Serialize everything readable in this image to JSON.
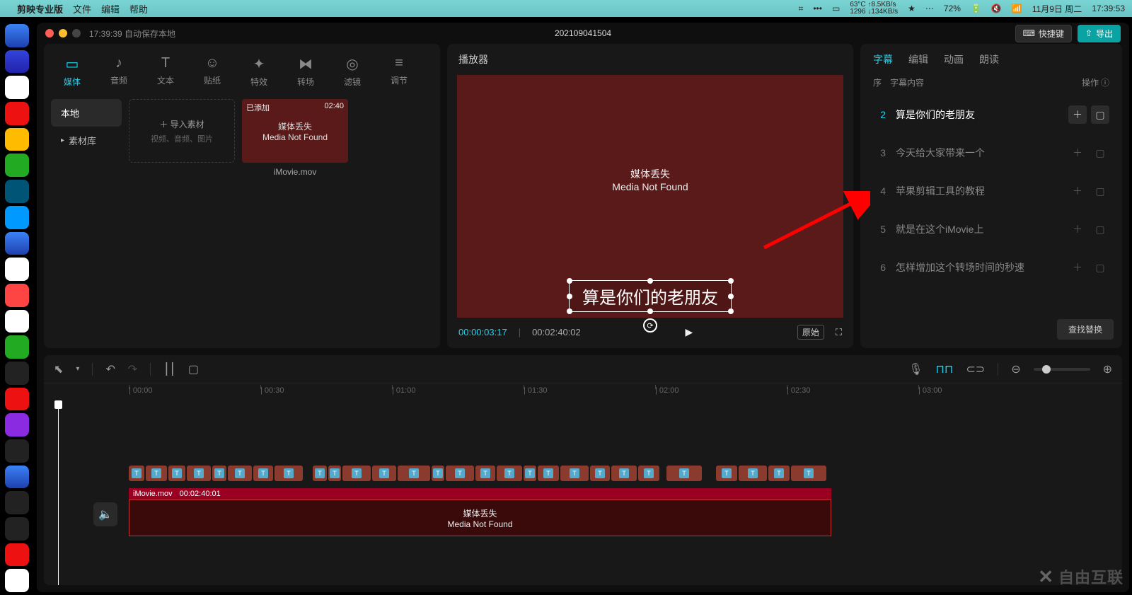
{
  "menubar": {
    "app": "剪映专业版",
    "items": [
      "文件",
      "编辑",
      "帮助"
    ],
    "sys": {
      "temp": "63°C",
      "up": "↑8.5KB/s",
      "cpu": "1296",
      "down": "↓134KB/s"
    },
    "battery": "72%",
    "date": "11月9日 周二",
    "time": "17:39:53"
  },
  "titlebar": {
    "autosave": "17:39:39 自动保存本地",
    "project": "202109041504",
    "shortcut": "快捷键",
    "export": "导出"
  },
  "media_tabs": [
    {
      "label": "媒体",
      "active": true
    },
    {
      "label": "音频"
    },
    {
      "label": "文本"
    },
    {
      "label": "贴纸"
    },
    {
      "label": "特效"
    },
    {
      "label": "转场"
    },
    {
      "label": "滤镜"
    },
    {
      "label": "调节"
    }
  ],
  "media_sub": [
    {
      "label": "本地",
      "active": true
    },
    {
      "label": "素材库"
    }
  ],
  "import": {
    "label": "导入素材",
    "hint": "视频、音频、图片"
  },
  "clip": {
    "added": "已添加",
    "dur": "02:40",
    "line1": "媒体丢失",
    "line2": "Media Not Found",
    "name": "iMovie.mov"
  },
  "player": {
    "title": "播放器",
    "mnf1": "媒体丢失",
    "mnf2": "Media Not Found",
    "subtitle": "算是你们的老朋友",
    "tc_cur": "00:00:03:17",
    "tc_total": "00:02:40:02",
    "orig": "原始"
  },
  "side": {
    "tabs": [
      "字幕",
      "编辑",
      "动画",
      "朗读"
    ],
    "head_idx": "序",
    "head_content": "字幕内容",
    "head_op": "操作",
    "rows": [
      {
        "idx": "2",
        "text": "算是你们的老朋友",
        "active": true
      },
      {
        "idx": "3",
        "text": "今天给大家带来一个"
      },
      {
        "idx": "4",
        "text": "苹果剪辑工具的教程"
      },
      {
        "idx": "5",
        "text": "就是在这个iMovie上"
      },
      {
        "idx": "6",
        "text": "怎样增加这个转场时间的秒速"
      }
    ],
    "find": "查找替换"
  },
  "timeline": {
    "marks": [
      "00:00",
      "00:30",
      "01:00",
      "01:30",
      "02:00",
      "02:30",
      "03:00"
    ],
    "clip_name": "iMovie.mov",
    "clip_dur": "00:02:40:01",
    "mnf1": "媒体丢失",
    "mnf2": "Media Not Found"
  },
  "watermark": "自由互联"
}
